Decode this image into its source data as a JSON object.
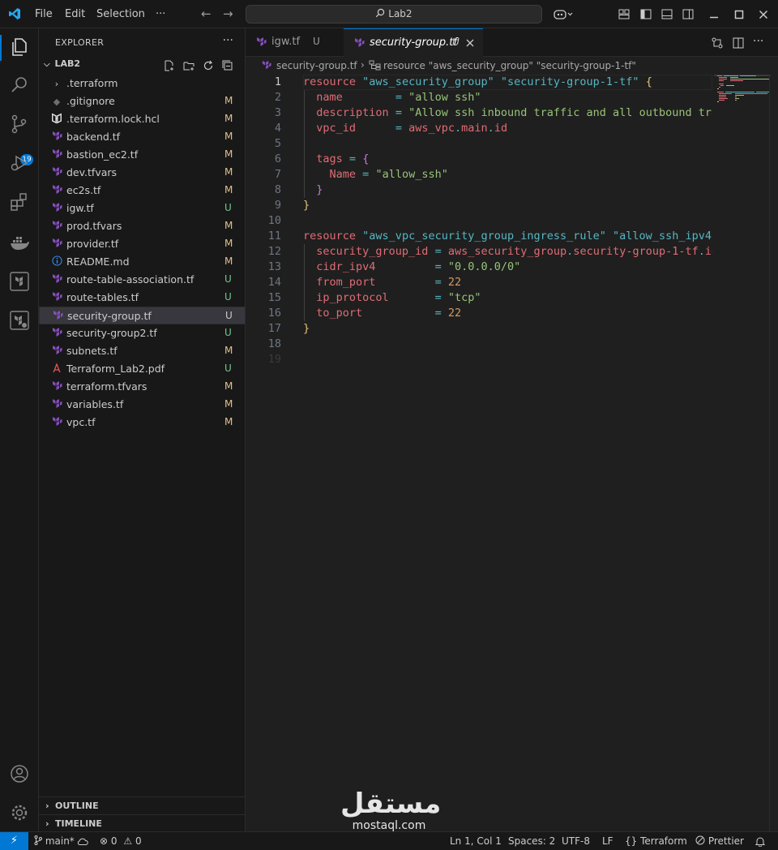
{
  "titlebar": {
    "menu": [
      "File",
      "Edit",
      "Selection",
      "···"
    ],
    "search_text": "Lab2"
  },
  "activity_bar": {
    "source_control_badge": "19"
  },
  "explorer": {
    "title": "EXPLORER",
    "root": "LAB2",
    "files": [
      {
        "name": ".terraform",
        "status": "",
        "kind": "folder"
      },
      {
        "name": ".gitignore",
        "status": "M",
        "kind": "git"
      },
      {
        "name": ".terraform.lock.hcl",
        "status": "M",
        "kind": "hcl"
      },
      {
        "name": "backend.tf",
        "status": "M",
        "kind": "tf"
      },
      {
        "name": "bastion_ec2.tf",
        "status": "M",
        "kind": "tf"
      },
      {
        "name": "dev.tfvars",
        "status": "M",
        "kind": "tf"
      },
      {
        "name": "ec2s.tf",
        "status": "M",
        "kind": "tf"
      },
      {
        "name": "igw.tf",
        "status": "U",
        "kind": "tf"
      },
      {
        "name": "prod.tfvars",
        "status": "M",
        "kind": "tf"
      },
      {
        "name": "provider.tf",
        "status": "M",
        "kind": "tf"
      },
      {
        "name": "README.md",
        "status": "M",
        "kind": "info"
      },
      {
        "name": "route-table-association.tf",
        "status": "U",
        "kind": "tf"
      },
      {
        "name": "route-tables.tf",
        "status": "U",
        "kind": "tf"
      },
      {
        "name": "security-group.tf",
        "status": "U",
        "kind": "tf",
        "selected": true
      },
      {
        "name": "security-group2.tf",
        "status": "U",
        "kind": "tf"
      },
      {
        "name": "subnets.tf",
        "status": "M",
        "kind": "tf"
      },
      {
        "name": "Terraform_Lab2.pdf",
        "status": "U",
        "kind": "pdf"
      },
      {
        "name": "terraform.tfvars",
        "status": "M",
        "kind": "tf"
      },
      {
        "name": "variables.tf",
        "status": "M",
        "kind": "tf"
      },
      {
        "name": "vpc.tf",
        "status": "M",
        "kind": "tf"
      }
    ],
    "outline": "OUTLINE",
    "timeline": "TIMELINE"
  },
  "tabs": [
    {
      "label": "igw.tf",
      "status": "U",
      "active": false
    },
    {
      "label": "security-group.tf",
      "status": "U",
      "active": true
    }
  ],
  "breadcrumb": {
    "file": "security-group.tf",
    "separator": "›",
    "symbol": "resource \"aws_security_group\" \"security-group-1-tf\""
  },
  "editor": {
    "line_numbers": [
      "1",
      "2",
      "3",
      "4",
      "5",
      "6",
      "7",
      "8",
      "9",
      "10",
      "11",
      "12",
      "13",
      "14",
      "15",
      "16",
      "17",
      "18",
      "19"
    ],
    "current_line": 1
  },
  "statusbar": {
    "branch": "main*",
    "problems": "0",
    "warnings": "0",
    "position": "Ln 1, Col 1",
    "spaces": "Spaces: 2",
    "encoding": "UTF-8",
    "eol": "LF",
    "language": "Terraform",
    "formatter": "Prettier"
  },
  "watermark": {
    "arabic": "مستقل",
    "latin": "mostaql.com"
  },
  "colors": {
    "accent": "#0078d4",
    "modified": "#e2c08d",
    "untracked": "#73c991",
    "terraform": "#844fba"
  }
}
